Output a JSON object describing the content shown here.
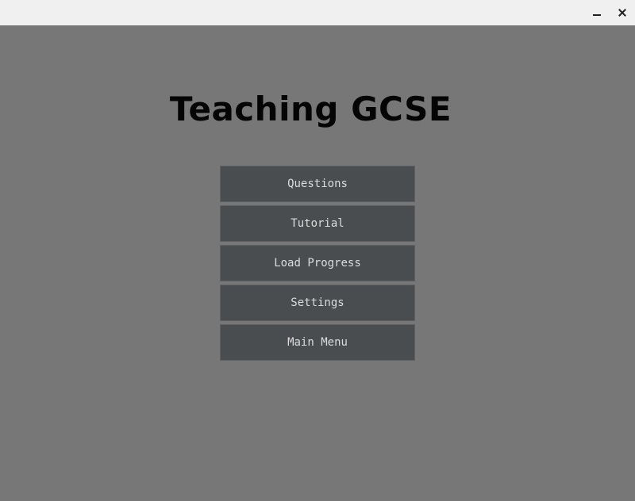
{
  "app": {
    "title": "Teaching GCSE"
  },
  "titlebar": {
    "minimize_icon": "minimize-icon",
    "close_icon": "close-icon"
  },
  "menu": {
    "items": [
      {
        "label": "Questions"
      },
      {
        "label": "Tutorial"
      },
      {
        "label": "Load Progress"
      },
      {
        "label": "Settings"
      },
      {
        "label": "Main Menu"
      }
    ]
  },
  "colors": {
    "background": "#777777",
    "titlebar": "#f0f0f0",
    "button_bg": "#4a4d50",
    "button_text": "#dcdcdc",
    "title_text": "#050505"
  }
}
